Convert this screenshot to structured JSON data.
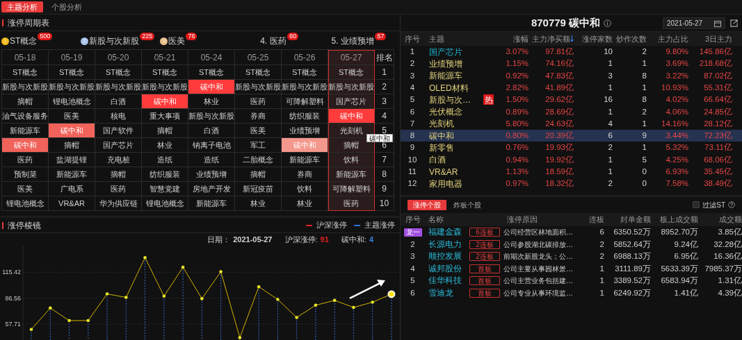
{
  "main_tabs": [
    {
      "label": "主题分析",
      "selected": true
    },
    {
      "label": "个股分析",
      "selected": false
    }
  ],
  "cycle_table": {
    "title": "涨停周期表",
    "leaders": [
      {
        "kind": "medal",
        "rank": "1",
        "name": "ST概念",
        "count": "500",
        "color": "#f2b91e"
      },
      {
        "kind": "medal",
        "rank": "2",
        "name": "新股与次新股",
        "count": "225",
        "color": "#a9c4ea"
      },
      {
        "kind": "medal",
        "rank": "3",
        "name": "医美",
        "count": "76",
        "color": "#e8bf8a"
      },
      {
        "kind": "plain",
        "rank": "4.",
        "name": "医药",
        "count": "60"
      },
      {
        "kind": "plain",
        "rank": "5.",
        "name": "业绩预增",
        "count": "57"
      }
    ],
    "rank_header": "排名",
    "ranks": [
      "1",
      "2",
      "3",
      "4",
      "5",
      "6",
      "7",
      "8",
      "9",
      "10"
    ],
    "columns": [
      {
        "date": "05-18",
        "selected": false,
        "cells": [
          {
            "text": "ST概念"
          },
          {
            "text": "新股与次新股"
          },
          {
            "text": "摘帽"
          },
          {
            "text": "油气设备服务"
          },
          {
            "text": "新能源车"
          },
          {
            "text": "碳中和",
            "color": "#f0625a"
          },
          {
            "text": "医药"
          },
          {
            "text": "预制菜"
          },
          {
            "text": "医美"
          },
          {
            "text": "锂电池概念"
          }
        ]
      },
      {
        "date": "05-19",
        "selected": false,
        "cells": [
          {
            "text": "ST概念"
          },
          {
            "text": "新股与次新股"
          },
          {
            "text": "锂电池概念"
          },
          {
            "text": "医美"
          },
          {
            "text": "碳中和",
            "color": "#f0625a"
          },
          {
            "text": "摘帽"
          },
          {
            "text": "盐湖提锂"
          },
          {
            "text": "新能源车"
          },
          {
            "text": "广电系"
          },
          {
            "text": "VR&AR"
          }
        ]
      },
      {
        "date": "05-20",
        "selected": false,
        "cells": [
          {
            "text": "ST概念"
          },
          {
            "text": "新股与次新股"
          },
          {
            "text": "白酒"
          },
          {
            "text": "核电"
          },
          {
            "text": "国产软件"
          },
          {
            "text": "国产芯片"
          },
          {
            "text": "充电桩"
          },
          {
            "text": "摘帽"
          },
          {
            "text": "医药"
          },
          {
            "text": "华为供应链"
          }
        ]
      },
      {
        "date": "05-21",
        "selected": false,
        "cells": [
          {
            "text": "ST概念"
          },
          {
            "text": "新股与次新股"
          },
          {
            "text": "碳中和",
            "color": "#ff3b3b"
          },
          {
            "text": "重大事项"
          },
          {
            "text": "摘帽"
          },
          {
            "text": "林业"
          },
          {
            "text": "造纸"
          },
          {
            "text": "纺织服装"
          },
          {
            "text": "智慧党建"
          },
          {
            "text": "锂电池概念"
          }
        ]
      },
      {
        "date": "05-24",
        "selected": false,
        "cells": [
          {
            "text": "ST概念"
          },
          {
            "text": "碳中和",
            "color": "#ff3b3b"
          },
          {
            "text": "林业"
          },
          {
            "text": "新股与次新股"
          },
          {
            "text": "白酒"
          },
          {
            "text": "钠离子电池"
          },
          {
            "text": "造纸"
          },
          {
            "text": "业绩预增"
          },
          {
            "text": "房地产开发"
          },
          {
            "text": "新能源车"
          }
        ]
      },
      {
        "date": "05-25",
        "selected": false,
        "cells": [
          {
            "text": "ST概念"
          },
          {
            "text": "新股与次新股"
          },
          {
            "text": "医药"
          },
          {
            "text": "券商"
          },
          {
            "text": "医美"
          },
          {
            "text": "军工"
          },
          {
            "text": "二胎概念"
          },
          {
            "text": "摘帽"
          },
          {
            "text": "新冠疫苗"
          },
          {
            "text": "林业"
          }
        ]
      },
      {
        "date": "05-26",
        "selected": false,
        "cells": [
          {
            "text": "ST概念"
          },
          {
            "text": "新股与次新股"
          },
          {
            "text": "可降解塑料"
          },
          {
            "text": "纺织服装"
          },
          {
            "text": "业绩预增"
          },
          {
            "text": "碳中和",
            "color": "#f4978c"
          },
          {
            "text": "新能源车"
          },
          {
            "text": "券商"
          },
          {
            "text": "饮料"
          },
          {
            "text": "林业"
          }
        ]
      },
      {
        "date": "05-27",
        "selected": true,
        "cells": [
          {
            "text": "ST概念"
          },
          {
            "text": "新股与次新股"
          },
          {
            "text": "国产芯片"
          },
          {
            "text": "碳中和",
            "color": "#ff3b3b"
          },
          {
            "text": "光刻机"
          },
          {
            "text": "摘帽"
          },
          {
            "text": "饮料"
          },
          {
            "text": "新能源车"
          },
          {
            "text": "可降解塑料"
          },
          {
            "text": "医药"
          }
        ]
      }
    ],
    "tooltip": "碳中和"
  },
  "mirror": {
    "title": "涨停棱镜",
    "legend": [
      {
        "label": "沪深涨停",
        "color": "#e02020"
      },
      {
        "label": "主题涨停",
        "color": "#2f6fd8"
      }
    ],
    "info": [
      {
        "label": "日期：",
        "value": "2021-05-27"
      },
      {
        "label": "沪深涨停:",
        "value": "91",
        "color": "#e02020"
      },
      {
        "label": "碳中和:",
        "value": "4",
        "color": "#3d7fe0"
      }
    ],
    "chart_data": {
      "type": "line",
      "ylim": [
        40,
        145
      ],
      "yticks": [
        57.71,
        86.56,
        115.42
      ],
      "grid": true,
      "series": [
        {
          "color": "#d4b400",
          "values": [
            51.8,
            75.6,
            61.6,
            61.6,
            91.3,
            87.4,
            131.7,
            88.8,
            121.0,
            86.0,
            116.0,
            42.6,
            99.2,
            85.2,
            65.0,
            78.7,
            84.1,
            76.2,
            82.1,
            91
          ]
        }
      ]
    }
  },
  "theme_panel": {
    "code": "870779",
    "name": "碳中和",
    "date": "2021-05-27",
    "columns": [
      {
        "label": "序号",
        "sorted": false
      },
      {
        "label": "主题",
        "sorted": false
      },
      {
        "label": "涨幅",
        "sorted": false
      },
      {
        "label": "主力净买额",
        "sorted": true
      },
      {
        "label": "涨停家数",
        "sorted": false
      },
      {
        "label": "炒作次数",
        "sorted": false
      },
      {
        "label": "主力占比",
        "sorted": false
      },
      {
        "label": "3日主力",
        "sorted": false
      }
    ],
    "rows": [
      {
        "no": "1",
        "theme": "国产芯片",
        "color": "#1fb8d8",
        "hot": false,
        "selected": false,
        "change": "3.07%",
        "net_buy": "97.81亿",
        "limit_up": "10",
        "hype": "2",
        "ratio": "9.80%",
        "three_day": "145.86亿"
      },
      {
        "no": "2",
        "theme": "业绩预增",
        "hot": false,
        "selected": false,
        "change": "1.15%",
        "net_buy": "74.16亿",
        "limit_up": "1",
        "hype": "1",
        "ratio": "3.69%",
        "three_day": "218.68亿"
      },
      {
        "no": "3",
        "theme": "新能源车",
        "hot": false,
        "selected": false,
        "change": "0.92%",
        "net_buy": "47.83亿",
        "limit_up": "3",
        "hype": "8",
        "ratio": "3.22%",
        "three_day": "87.02亿"
      },
      {
        "no": "4",
        "theme": "OLED材料",
        "hot": false,
        "selected": false,
        "change": "2.82%",
        "net_buy": "41.89亿",
        "limit_up": "1",
        "hype": "1",
        "ratio": "10.93%",
        "three_day": "55.31亿"
      },
      {
        "no": "5",
        "theme": "新股与次…",
        "hot": true,
        "hot_label": "热",
        "selected": false,
        "change": "1.50%",
        "net_buy": "29.62亿",
        "limit_up": "16",
        "hype": "8",
        "ratio": "4.02%",
        "three_day": "66.64亿"
      },
      {
        "no": "6",
        "theme": "光伏概念",
        "hot": false,
        "selected": false,
        "change": "0.89%",
        "net_buy": "28.69亿",
        "limit_up": "1",
        "hype": "2",
        "ratio": "4.06%",
        "three_day": "24.85亿"
      },
      {
        "no": "7",
        "theme": "光刻机",
        "hot": false,
        "selected": false,
        "change": "5.80%",
        "net_buy": "24.63亿",
        "limit_up": "4",
        "hype": "1",
        "ratio": "14.16%",
        "three_day": "28.12亿"
      },
      {
        "no": "8",
        "theme": "碳中和",
        "hot": false,
        "selected": true,
        "change": "0.80%",
        "net_buy": "20.39亿",
        "limit_up": "6",
        "hype": "9",
        "ratio": "3.44%",
        "three_day": "72.23亿"
      },
      {
        "no": "9",
        "theme": "新零售",
        "hot": false,
        "selected": false,
        "change": "0.76%",
        "net_buy": "19.93亿",
        "limit_up": "2",
        "hype": "1",
        "ratio": "5.32%",
        "three_day": "73.11亿"
      },
      {
        "no": "10",
        "theme": "白酒",
        "hot": false,
        "selected": false,
        "change": "0.94%",
        "net_buy": "19.92亿",
        "limit_up": "1",
        "hype": "5",
        "ratio": "4.25%",
        "three_day": "68.06亿"
      },
      {
        "no": "11",
        "theme": "VR&AR",
        "hot": false,
        "selected": false,
        "change": "1.13%",
        "net_buy": "18.59亿",
        "limit_up": "1",
        "hype": "0",
        "ratio": "6.93%",
        "three_day": "35.45亿"
      },
      {
        "no": "12",
        "theme": "家用电器",
        "hot": false,
        "selected": false,
        "change": "0.97%",
        "net_buy": "18.32亿",
        "limit_up": "2",
        "hype": "0",
        "ratio": "7.58%",
        "three_day": "38.49亿"
      }
    ]
  },
  "stocks_panel": {
    "tabs": [
      {
        "label": "涨停个股",
        "selected": true
      },
      {
        "label": "炸板个股",
        "selected": false
      }
    ],
    "filter": {
      "label": "过滤ST",
      "checked": false
    },
    "columns": [
      "序号",
      "名称",
      "涨停原因",
      "连板",
      "封单金额",
      "板上成交额",
      "成交额"
    ],
    "rows": [
      {
        "rank": "龙一",
        "leader": true,
        "name": "福建金森",
        "tag": "6连板",
        "reason": "公司经营区林地面积…",
        "boards": "6",
        "seal": "6350.52万",
        "on_board": "8952.70万",
        "turnover": "3.85亿"
      },
      {
        "rank": "2",
        "leader": false,
        "name": "长源电力",
        "tag": "2连板",
        "reason": "公司参股湖北碳排放…",
        "boards": "2",
        "seal": "5852.64万",
        "on_board": "9.24亿",
        "turnover": "32.28亿"
      },
      {
        "rank": "3",
        "leader": false,
        "name": "顺控发展",
        "tag": "2连板",
        "reason": "前期次新股龙头；公…",
        "boards": "2",
        "seal": "6988.13万",
        "on_board": "6.95亿",
        "turnover": "16.36亿"
      },
      {
        "rank": "4",
        "leader": false,
        "name": "诚邦股份",
        "tag": "首板",
        "reason": "公司主要从事园林景…",
        "boards": "1",
        "seal": "3111.89万",
        "on_board": "5633.39万",
        "turnover": "7985.37万"
      },
      {
        "rank": "5",
        "leader": false,
        "name": "佳华科技",
        "tag": "首板",
        "reason": "公司主营业务包括建…",
        "boards": "1",
        "seal": "3389.52万",
        "on_board": "6583.94万",
        "turnover": "1.31亿"
      },
      {
        "rank": "6",
        "leader": false,
        "name": "雪迪龙",
        "tag": "首板",
        "reason": "公司专业从事环境监…",
        "boards": "1",
        "seal": "6249.92万",
        "on_board": "1.41亿",
        "turnover": "4.39亿"
      }
    ]
  }
}
